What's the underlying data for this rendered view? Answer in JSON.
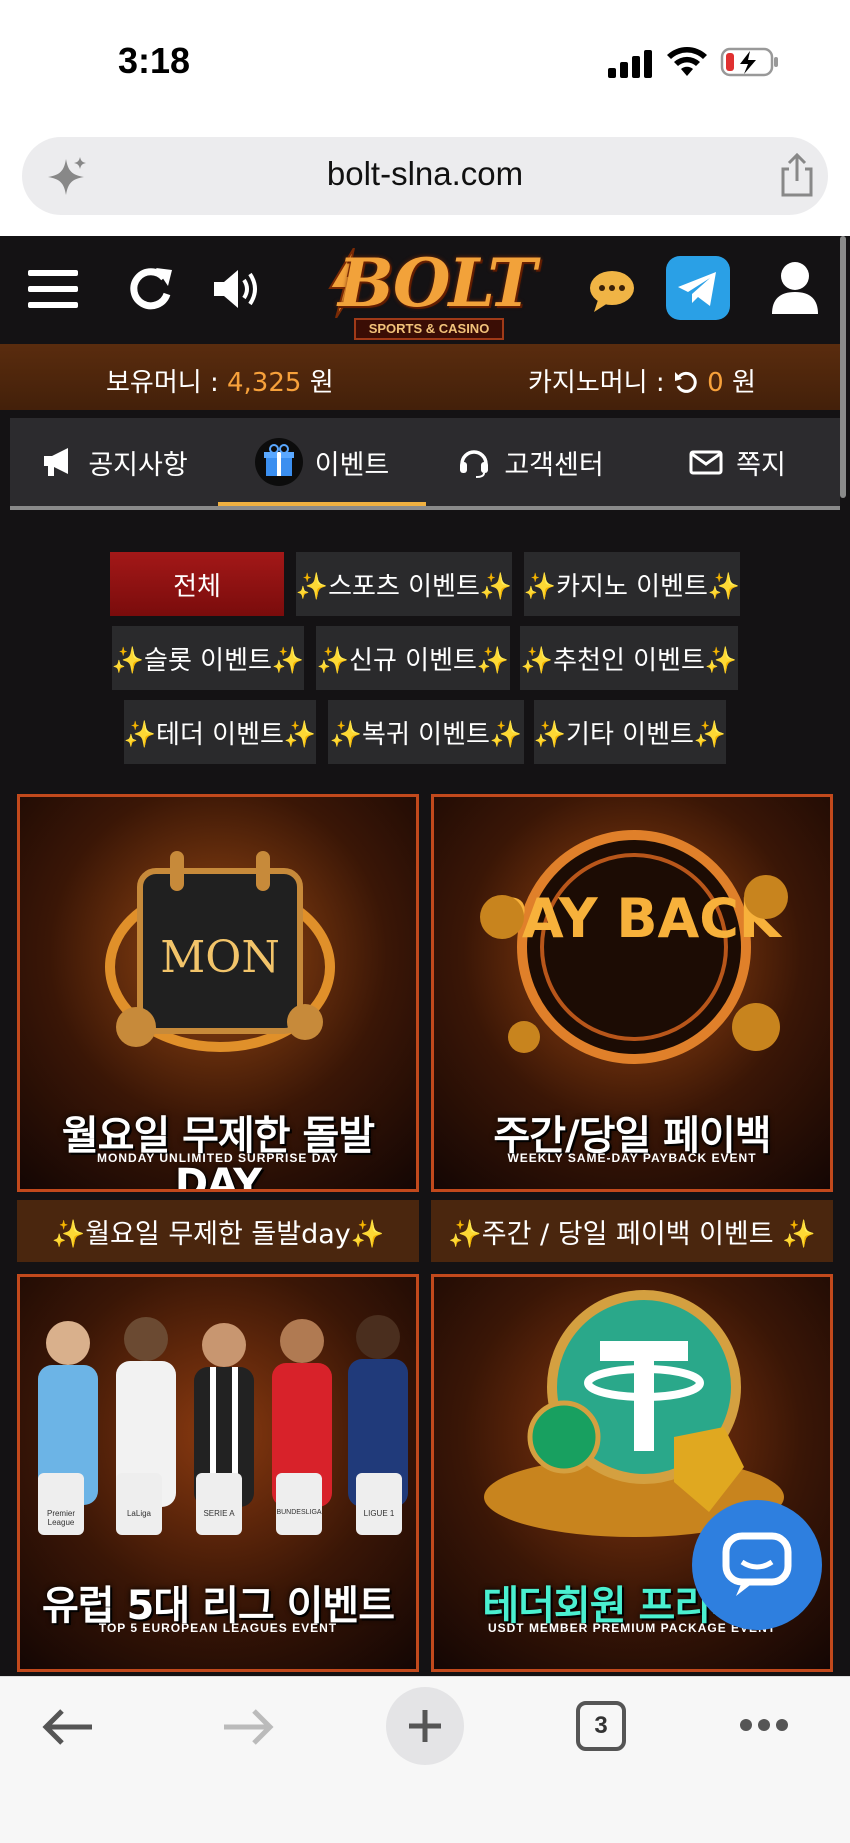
{
  "status_bar": {
    "time": "3:18"
  },
  "browser": {
    "url": "bolt-slna.com",
    "tab_count": "3"
  },
  "site": {
    "logo": {
      "main": "BOLT",
      "sub": "SPORTS & CASINO"
    },
    "money": {
      "holding_label": "보유머니 :",
      "holding_value": "4,325",
      "holding_unit": "원",
      "casino_label": "카지노머니 :",
      "casino_value": "0",
      "casino_unit": "원"
    },
    "tabs": [
      {
        "label": "공지사항",
        "icon": "megaphone-icon"
      },
      {
        "label": "이벤트",
        "icon": "gift-icon"
      },
      {
        "label": "고객센터",
        "icon": "headset-icon"
      },
      {
        "label": "쪽지",
        "icon": "envelope-icon"
      }
    ],
    "filters": [
      "전체",
      "✨스포츠 이벤트✨",
      "✨카지노 이벤트✨",
      "✨슬롯 이벤트✨",
      "✨신규 이벤트✨",
      "✨추천인 이벤트✨",
      "✨테더 이벤트✨",
      "✨복귀 이벤트✨",
      "✨기타 이벤트✨"
    ],
    "events": [
      {
        "banner_text": "MON",
        "title_ko": "월요일 무제한 돌발 DAY",
        "title_en": "MONDAY UNLIMITED SURPRISE DAY",
        "caption": "✨월요일 무제한 돌발day✨"
      },
      {
        "banner_text": "PAY BACK",
        "title_ko": "주간/당일 페이백",
        "title_en": "WEEKLY SAME-DAY PAYBACK EVENT",
        "caption": "✨주간 / 당일 페이백 이벤트 ✨"
      },
      {
        "banner_text": "",
        "title_ko": "유럽 5대 리그 이벤트",
        "title_en": "TOP 5 EUROPEAN LEAGUES EVENT",
        "caption": "",
        "league_badges": [
          "Premier League",
          "LaLiga",
          "SERIE A",
          "BUNDESLIGA",
          "LIGUE 1"
        ]
      },
      {
        "banner_text": "",
        "title_ko": "테더회원 프리미엄",
        "title_en": "USDT MEMBER PREMIUM PACKAGE EVENT",
        "caption": ""
      }
    ]
  },
  "colors": {
    "accent": "#f7a13b",
    "active_filter": "#a31818",
    "card_border": "#c2491c",
    "chat": "#2e7fdf"
  }
}
